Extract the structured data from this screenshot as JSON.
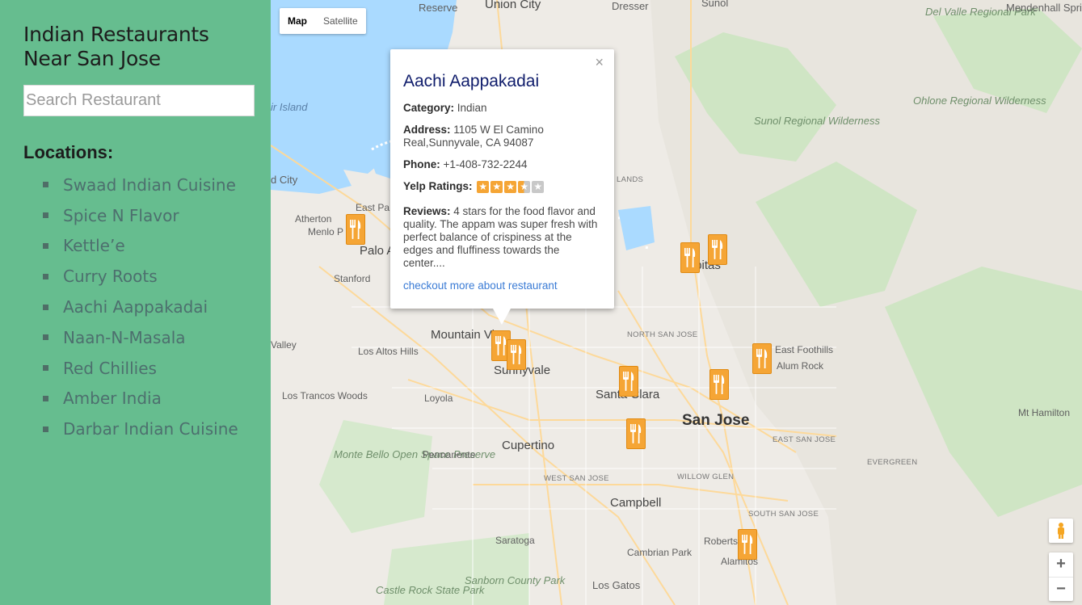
{
  "sidebar": {
    "title": "Indian Restaurants Near San Jose",
    "search_placeholder": "Search Restaurant",
    "locations_heading": "Locations:",
    "items": [
      "Swaad Indian Cuisine",
      "Spice N Flavor",
      "Kettle’e",
      "Curry Roots",
      "Aachi Aappakadai",
      "Naan-N-Masala",
      "Red Chillies",
      "Amber India",
      "Darbar Indian Cuisine"
    ]
  },
  "map": {
    "type_map": "Map",
    "type_satellite": "Satellite",
    "labels": {
      "reserve": "Reserve",
      "union_city": "Union City",
      "dresser": "Dresser",
      "sunol_top": "Sunol",
      "del_valle": "Del Valle Regional Park",
      "mendenhall": "Mendenhall Springs",
      "air_island": "ir Island",
      "sunol_wild": "Sunol Regional Wilderness",
      "ohlone": "Ohlone Regional Wilderness",
      "d_city": "d City",
      "east_pa": "East Pa",
      "atherton": "Atherton",
      "menlo": "Menlo P",
      "palo_alto": "Palo A",
      "stanford": "Stanford",
      "milpitas": "Milpitas",
      "lands": "LANDS",
      "valley": "Valley",
      "los_altos_hills": "Los Altos Hills",
      "mountain_view": "Mountain View",
      "sunnyvale": "Sunnyvale",
      "north_san_jose": "NORTH SAN JOSE",
      "east_foothills": "East Foothills",
      "alum_rock": "Alum Rock",
      "santa_clara": "Santa Clara",
      "san_jose": "San Jose",
      "los_trancos": "Los Trancos Woods",
      "loyola": "Loyola",
      "mt_hamilton": "Mt Hamilton",
      "east_san_jose": "EAST SAN JOSE",
      "monte_bello": "Monte Bello Open Space Preserve",
      "permanente": "Permanente",
      "cupertino": "Cupertino",
      "evergreen": "EVERGREEN",
      "west_san_jose": "WEST SAN JOSE",
      "willow_glen": "WILLOW GLEN",
      "campbell": "Campbell",
      "south_san_jose": "SOUTH SAN JOSE",
      "saratoga": "Saratoga",
      "roberts": "Roberts",
      "cambrian_park": "Cambrian Park",
      "alamitos": "Alamitos",
      "los_gatos": "Los Gatos",
      "castle_rock": "Castle Rock State Park",
      "sanborn": "Sanborn County Park"
    },
    "zoom_in": "+",
    "zoom_out": "−"
  },
  "info_window": {
    "name": "Aachi Aappakadai",
    "category_label": "Category:",
    "category": "Indian",
    "address_label": "Address:",
    "address": "1105 W El Camino Real,Sunnyvale, CA 94087",
    "phone_label": "Phone:",
    "phone": "+1-408-732-2244",
    "rating_label": "Yelp Ratings:",
    "rating": 3.5,
    "rating_max": 5,
    "reviews_label": "Reviews:",
    "reviews": "4 stars for the food flavor and quality. The appam was super fresh with perfect balance of crispiness at the edges and fluffiness towards the center....",
    "link": "checkout more about restaurant",
    "close": "×"
  },
  "colors": {
    "sidebar_bg": "#66bd8f",
    "marker": "#f5a535",
    "star_on": "#f5a535",
    "star_off": "#c8c8c8",
    "link": "#3a7bd5",
    "title": "#0f1c6b"
  }
}
